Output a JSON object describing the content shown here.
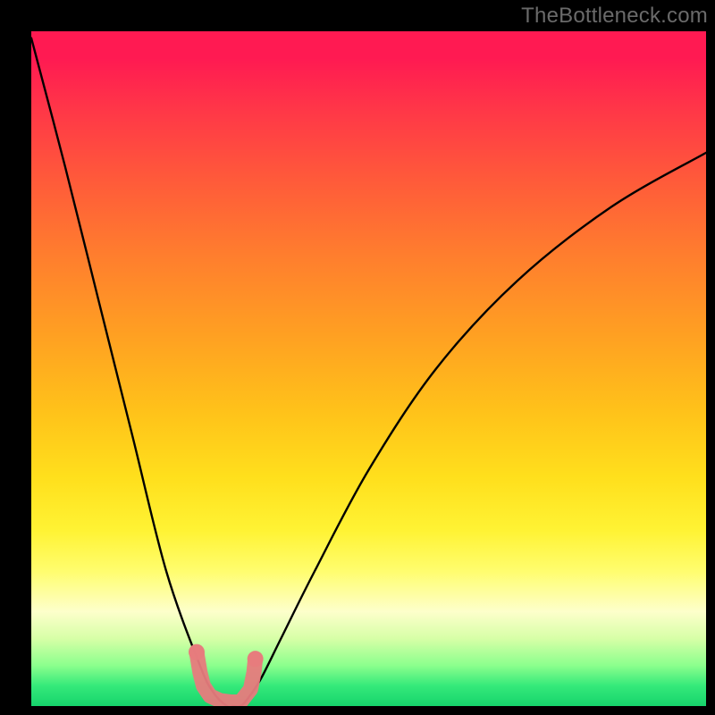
{
  "watermark": "TheBottleneck.com",
  "chart_data": {
    "type": "line",
    "title": "",
    "xlabel": "",
    "ylabel": "",
    "xlim": [
      0,
      100
    ],
    "ylim": [
      0,
      100
    ],
    "grid": false,
    "legend": false,
    "background_gradient": {
      "stops": [
        {
          "pos": 0.0,
          "color": "#ff1a52"
        },
        {
          "pos": 0.5,
          "color": "#ffc11a"
        },
        {
          "pos": 0.8,
          "color": "#fffd6e"
        },
        {
          "pos": 0.95,
          "color": "#8bff8d"
        },
        {
          "pos": 1.0,
          "color": "#16d46c"
        }
      ]
    },
    "series": [
      {
        "name": "bottleneck-curve",
        "stroke": "#000000",
        "x": [
          0,
          5,
          10,
          15,
          20,
          25,
          27,
          29,
          30,
          31,
          32,
          34,
          37,
          42,
          50,
          60,
          72,
          86,
          100
        ],
        "y": [
          99,
          80,
          60,
          40,
          20,
          6,
          2,
          0,
          0,
          0,
          1,
          4,
          10,
          20,
          35,
          50,
          63,
          74,
          82
        ]
      }
    ],
    "markers": [
      {
        "name": "highlight-region",
        "color": "#e77b7d",
        "points": [
          {
            "x": 24.5,
            "y": 8
          },
          {
            "x": 25.0,
            "y": 5
          },
          {
            "x": 25.5,
            "y": 3
          },
          {
            "x": 26.5,
            "y": 1.5
          },
          {
            "x": 28.0,
            "y": 0.8
          },
          {
            "x": 29.5,
            "y": 0.6
          },
          {
            "x": 31.0,
            "y": 0.6
          },
          {
            "x": 32.5,
            "y": 2.5
          },
          {
            "x": 33.0,
            "y": 5
          },
          {
            "x": 33.2,
            "y": 7
          }
        ]
      }
    ]
  }
}
